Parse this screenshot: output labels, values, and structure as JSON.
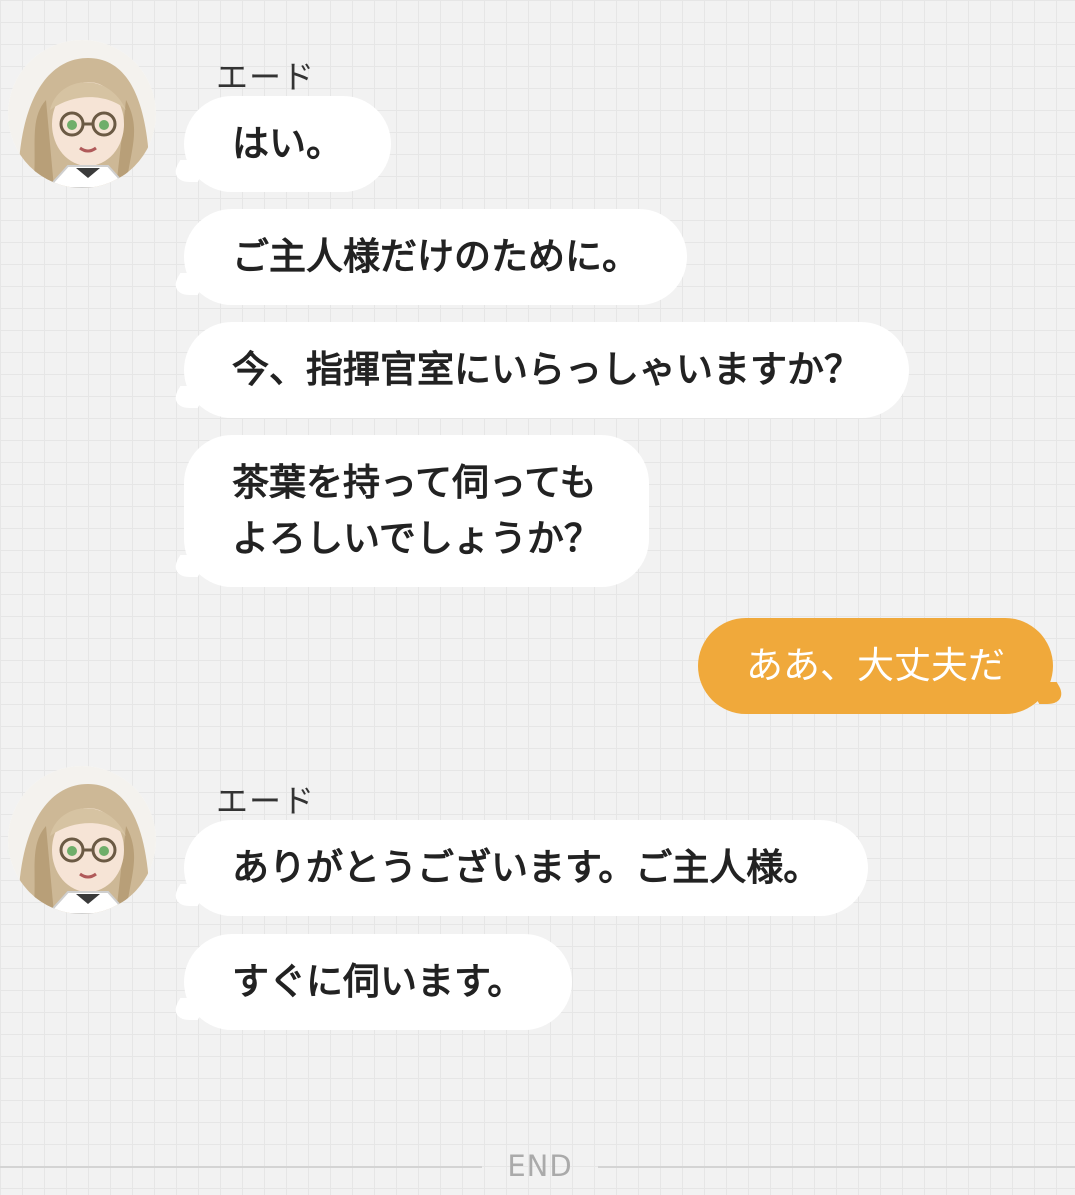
{
  "groups": [
    {
      "sender": "エード",
      "messages": [
        "はい。",
        "ご主人様だけのために。",
        "今、指揮官室にいらっしゃいますか？",
        "茶葉を持って伺っても\nよろしいでしょうか？"
      ]
    },
    {
      "sender": "user",
      "messages": [
        "ああ、大丈夫だ"
      ]
    },
    {
      "sender": "エード",
      "messages": [
        "ありがとうございます。ご主人様。",
        "すぐに伺います。"
      ]
    }
  ],
  "footer": {
    "label": "END"
  },
  "icons": {
    "avatar": "character-avatar-icon"
  },
  "colors": {
    "background": "#f2f2f2",
    "incoming_bubble": "#ffffff",
    "outgoing_bubble": "#f0a93b",
    "outgoing_text": "#ffffff",
    "text": "#222222"
  }
}
